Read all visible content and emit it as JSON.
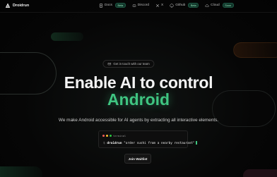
{
  "brand": {
    "name": "Droidrun",
    "icon": "droidrun-logo-icon"
  },
  "nav": {
    "items": [
      {
        "label": "Docs",
        "icon": "document-icon",
        "badge": "Beta"
      },
      {
        "label": "Discord",
        "icon": "discord-icon",
        "badge": ""
      },
      {
        "label": "X",
        "icon": "x-icon",
        "badge": ""
      },
      {
        "label": "Github",
        "icon": "github-icon",
        "badge": "Beta"
      },
      {
        "label": "Cloud",
        "icon": "cloud-icon",
        "badge": "Soon"
      }
    ]
  },
  "hero": {
    "contact_label": "Get in touch with our team",
    "contact_icon": "mail-icon",
    "headline": "Enable AI to control",
    "headline_accent": "Android",
    "subtitle": "We make Android accessible for AI agents by extracting all interactive elements."
  },
  "terminal": {
    "title": "terminal",
    "prompt": "$",
    "command": "droidrun",
    "argument": "\"order sushi from a nearby restaurant\""
  },
  "cta": {
    "label": "Join Waitlist"
  },
  "colors": {
    "background": "#050505",
    "accent": "#3fc581",
    "badge_bg": "#12352a",
    "badge_text": "#8fe3b5",
    "dot_red": "#ff5f57",
    "dot_yellow": "#febc2e",
    "dot_green": "#28c840"
  }
}
